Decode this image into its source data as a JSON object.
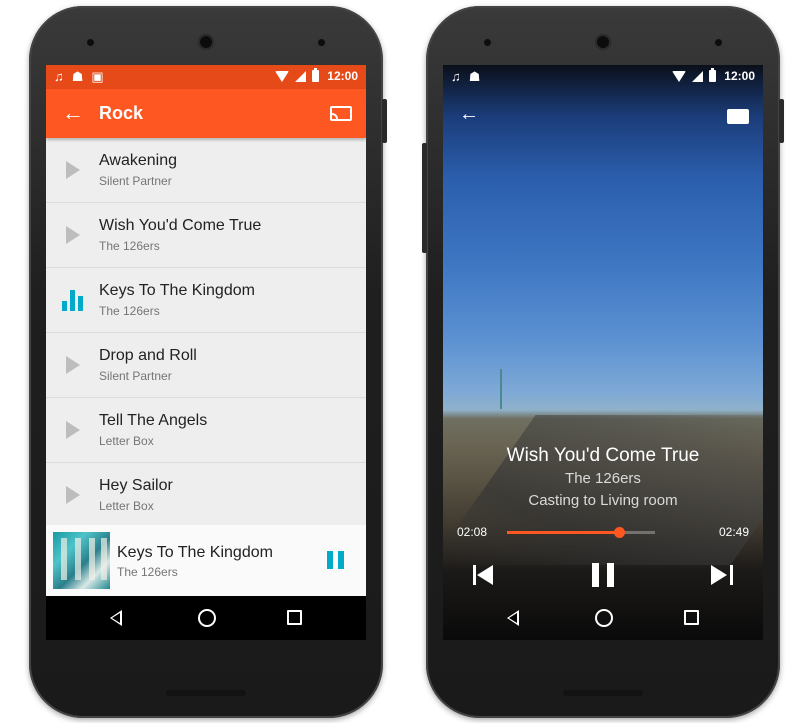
{
  "status_bar": {
    "time": "12:00"
  },
  "library": {
    "title": "Rock",
    "tracks": [
      {
        "title": "Awakening",
        "artist": "Silent Partner"
      },
      {
        "title": "Wish You'd Come True",
        "artist": "The 126ers"
      },
      {
        "title": "Keys To The Kingdom",
        "artist": "The 126ers"
      },
      {
        "title": "Drop and Roll",
        "artist": "Silent Partner"
      },
      {
        "title": "Tell The Angels",
        "artist": "Letter Box"
      },
      {
        "title": "Hey Sailor",
        "artist": "Letter Box"
      }
    ],
    "playing_index": 2,
    "mini_player": {
      "title": "Keys To The Kingdom",
      "artist": "The 126ers"
    }
  },
  "now_playing": {
    "title": "Wish You'd Come True",
    "artist": "The 126ers",
    "cast_status": "Casting to Living room",
    "elapsed": "02:08",
    "duration": "02:49",
    "progress": 0.757
  },
  "colors": {
    "primary": "#ff5722",
    "primary_dark": "#e64a19",
    "accent": "#03a9c9"
  },
  "icons": [
    "music-note-icon",
    "android-icon",
    "gallery-icon",
    "wifi-icon",
    "signal-icon",
    "battery-icon",
    "back-arrow-icon",
    "cast-icon",
    "play-icon",
    "equalizer-icon",
    "pause-icon",
    "skip-previous-icon",
    "skip-next-icon",
    "nav-back-icon",
    "nav-home-icon",
    "nav-recents-icon"
  ]
}
